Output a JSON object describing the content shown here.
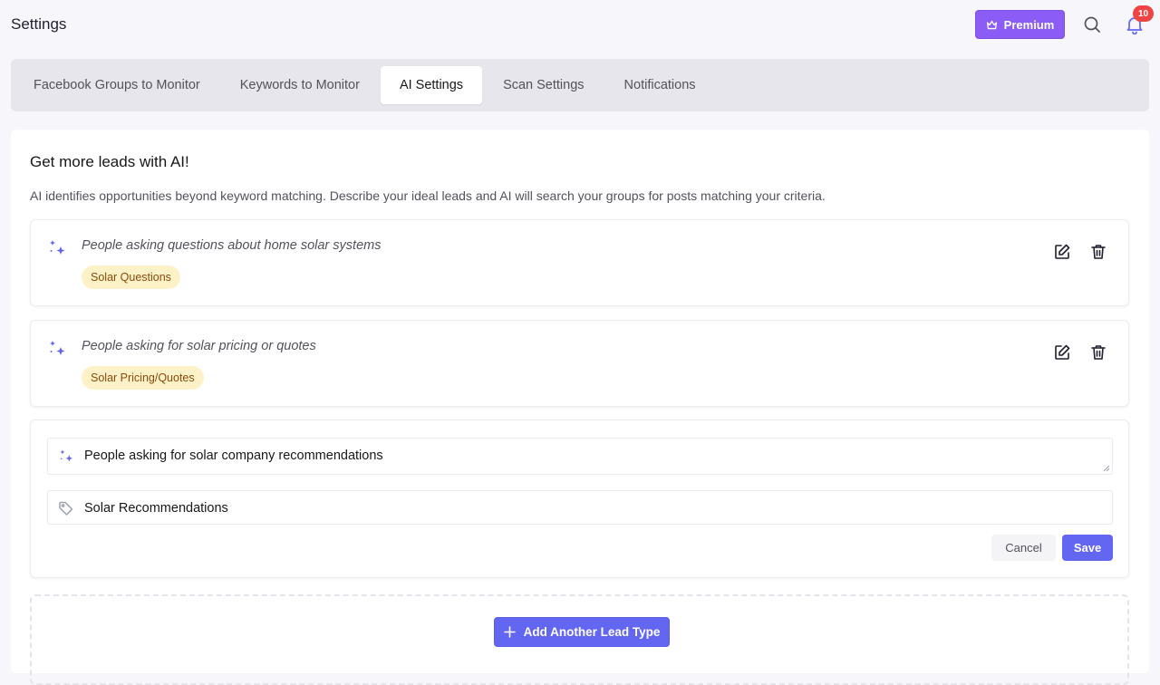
{
  "header": {
    "title": "Settings",
    "premium_label": "Premium",
    "notification_count": "10"
  },
  "tabs": [
    {
      "label": "Facebook Groups to Monitor",
      "active": false
    },
    {
      "label": "Keywords to Monitor",
      "active": false
    },
    {
      "label": "AI Settings",
      "active": true
    },
    {
      "label": "Scan Settings",
      "active": false
    },
    {
      "label": "Notifications",
      "active": false
    }
  ],
  "main": {
    "heading": "Get more leads with AI!",
    "description": "AI identifies opportunities beyond keyword matching. Describe your ideal leads and AI will search your groups for posts matching your criteria."
  },
  "lead_types": [
    {
      "description": "People asking questions about home solar systems",
      "tag": "Solar Questions"
    },
    {
      "description": "People asking for solar pricing or quotes",
      "tag": "Solar Pricing/Quotes"
    }
  ],
  "editor": {
    "description_value": "People asking for solar company recommendations",
    "tag_value": "Solar Recommendations",
    "cancel_label": "Cancel",
    "save_label": "Save"
  },
  "add_button_label": "Add Another Lead Type",
  "colors": {
    "accent": "#6366f1",
    "premium": "#8b5cf6",
    "tag_bg": "#fdf1c8",
    "tag_text": "#8a4b0b",
    "badge": "#ef4444"
  }
}
